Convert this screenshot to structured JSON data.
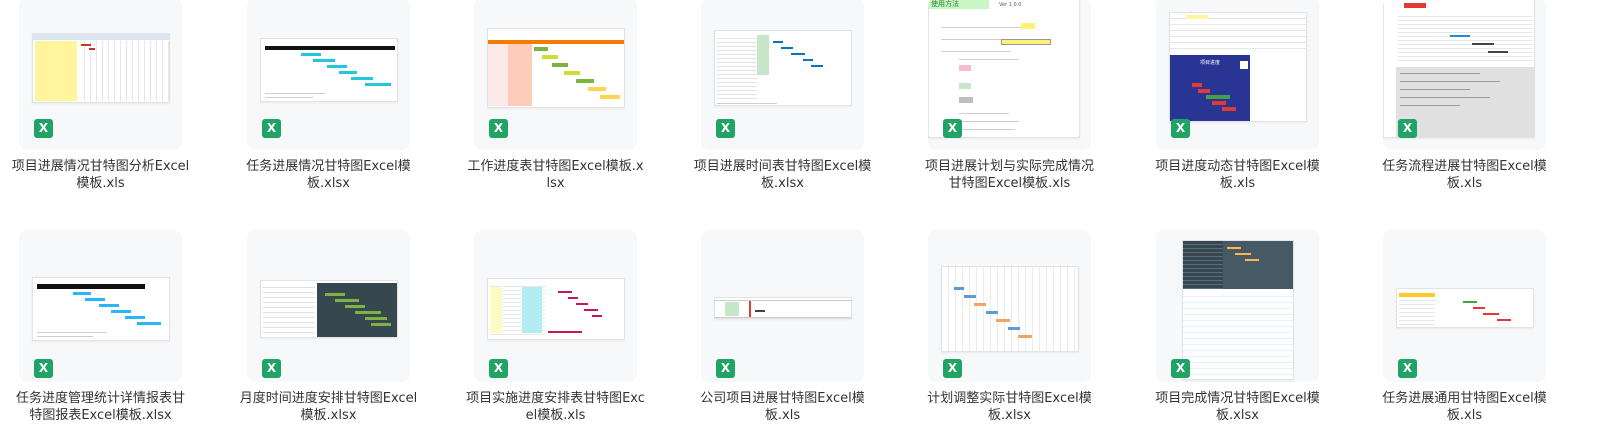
{
  "colors": {
    "tile_bg": "#f7f8fa",
    "excel_green": "#21a366",
    "title_text": "#333333"
  },
  "icon": {
    "name": "excel-file-icon",
    "glyph": "X"
  },
  "files": [
    {
      "title": "项目进展情况甘特图分析Excel模板.xls"
    },
    {
      "title": "任务进展情况甘特图Excel模板.xlsx"
    },
    {
      "title": "工作进度表甘特图Excel模板.xlsx"
    },
    {
      "title": "项目进展时间表甘特图Excel模板.xlsx"
    },
    {
      "title": "项目进展计划与实际完成情况甘特图Excel模板.xls"
    },
    {
      "title": "项目进度动态甘特图Excel模板.xls"
    },
    {
      "title": "任务流程进展甘特图Excel模板.xls"
    },
    {
      "title": "任务进度管理统计详情报表甘特图报表Excel模板.xlsx"
    },
    {
      "title": "月度时间进度安排甘特图Excel模板.xlsx"
    },
    {
      "title": "项目实施进度安排表甘特图Excel模板.xls"
    },
    {
      "title": "公司项目进展甘特图Excel模板.xls"
    },
    {
      "title": "计划调整实际甘特图Excel模板.xlsx"
    },
    {
      "title": "项目完成情况甘特图Excel模板.xlsx"
    },
    {
      "title": "任务进展通用甘特图Excel模板.xls"
    }
  ],
  "previews": {
    "usage_title": "使用方法",
    "version": "Ver 1.0.0",
    "project_status": "项目进度"
  }
}
